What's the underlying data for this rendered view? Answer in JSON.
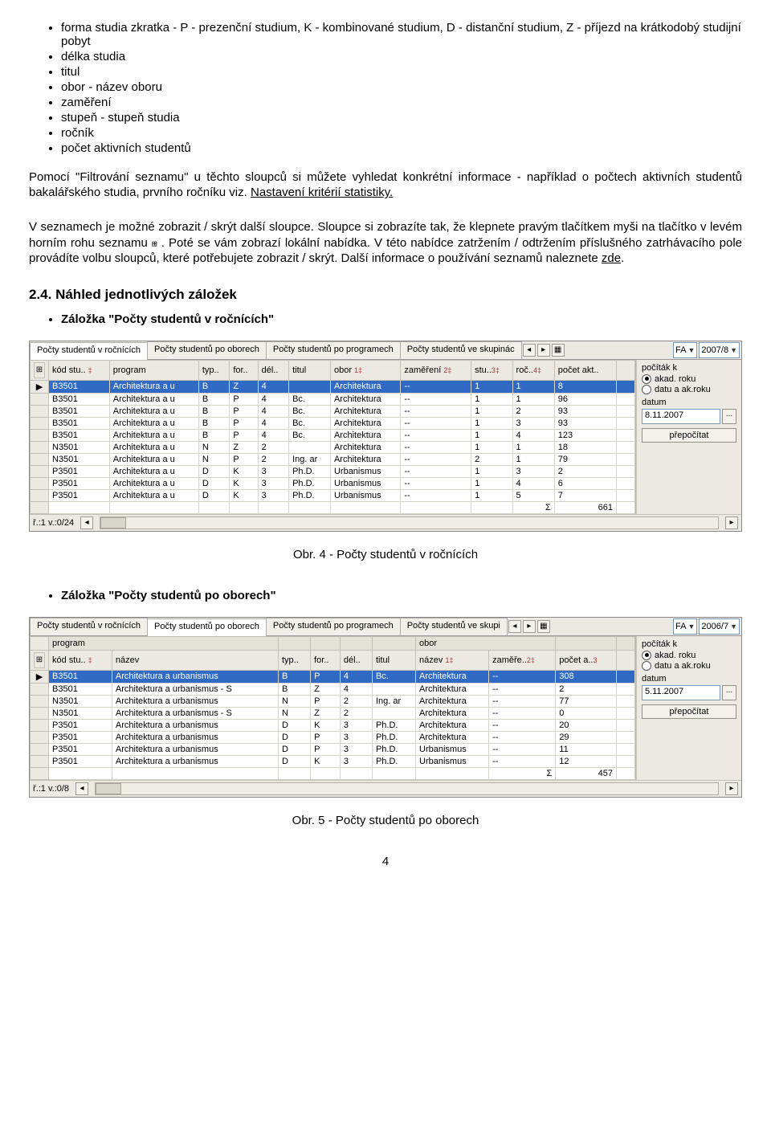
{
  "bullets_top": [
    "forma studia zkratka - P - prezenční studium, K - kombinované studium, D - distanční studium, Z - příjezd na krátkodobý studijní pobyt",
    "délka studia",
    "titul",
    "obor - název oboru",
    "zaměření",
    "stupeň - stupeň studia",
    "ročník",
    "počet aktivních studentů"
  ],
  "para1_a": "Pomocí \"Filtrování seznamu\" u těchto sloupců si můžete vyhledat konkrétní informace - například o počtech aktivních studentů bakalářského studia, prvního ročníku viz. ",
  "para1_link": "Nastavení kritérií statistiky.",
  "para2_a": "V seznamech je možné zobrazit / skrýt další sloupce. Sloupce si zobrazíte tak, že klepnete pravým tlačítkem myši na tlačítko v levém horním rohu seznamu ",
  "para2_b": ". Poté se vám zobrazí lokální nabídka. V této nabídce zatržením / odtržením příslušného zatrhávacího pole provádíte volbu sloupců, které potřebujete zobrazit / skrýt. Další informace o používání seznamů naleznete ",
  "para2_link": "zde",
  "sec_heading": "2.4. Náhled jednotlivých záložek",
  "tab1_title": "Záložka \"Počty studentů v ročnících\"",
  "tab2_title": "Záložka \"Počty studentů po oborech\"",
  "caption1": "Obr. 4 - Počty studentů v ročnících",
  "caption2": "Obr. 5 - Počty studentů po oborech",
  "pagenum": "4",
  "shot1": {
    "tabs": [
      "Počty studentů v ročnících",
      "Počty studentů po oborech",
      "Počty studentů po programech",
      "Počty studentů ve skupinác"
    ],
    "active_tab": 0,
    "fa": "FA",
    "year": "2007/8",
    "headers": [
      "kód stu..",
      "program",
      "typ..",
      "for..",
      "dél..",
      "titul",
      "obor",
      "zaměření",
      "stu..",
      "roč..",
      "počet akt.."
    ],
    "sort_cols": {
      "6": "1",
      "7": "2",
      "8": "3",
      "9": "4"
    },
    "rows": [
      [
        "B3501",
        "Architektura a u",
        "B",
        "Z",
        "4",
        "",
        "Architektura",
        "--",
        "1",
        "1",
        "8"
      ],
      [
        "B3501",
        "Architektura a u",
        "B",
        "P",
        "4",
        "Bc.",
        "Architektura",
        "--",
        "1",
        "1",
        "96"
      ],
      [
        "B3501",
        "Architektura a u",
        "B",
        "P",
        "4",
        "Bc.",
        "Architektura",
        "--",
        "1",
        "2",
        "93"
      ],
      [
        "B3501",
        "Architektura a u",
        "B",
        "P",
        "4",
        "Bc.",
        "Architektura",
        "--",
        "1",
        "3",
        "93"
      ],
      [
        "B3501",
        "Architektura a u",
        "B",
        "P",
        "4",
        "Bc.",
        "Architektura",
        "--",
        "1",
        "4",
        "123"
      ],
      [
        "N3501",
        "Architektura a u",
        "N",
        "Z",
        "2",
        "",
        "Architektura",
        "--",
        "1",
        "1",
        "18"
      ],
      [
        "N3501",
        "Architektura a u",
        "N",
        "P",
        "2",
        "Ing. ar",
        "Architektura",
        "--",
        "2",
        "1",
        "79"
      ],
      [
        "P3501",
        "Architektura a u",
        "D",
        "K",
        "3",
        "Ph.D.",
        "Urbanismus",
        "--",
        "1",
        "3",
        "2"
      ],
      [
        "P3501",
        "Architektura a u",
        "D",
        "K",
        "3",
        "Ph.D.",
        "Urbanismus",
        "--",
        "1",
        "4",
        "6"
      ],
      [
        "P3501",
        "Architektura a u",
        "D",
        "K",
        "3",
        "Ph.D.",
        "Urbanismus",
        "--",
        "1",
        "5",
        "7"
      ]
    ],
    "sum_label": "Σ",
    "sum": "661",
    "side": {
      "pocitak": "počíták k",
      "r1": "akad. roku",
      "r2": "datu a ak.roku",
      "datum_lbl": "datum",
      "datum_val": "8.11.2007",
      "btn": "přepočítat"
    },
    "status": "ř.:1 v.:0/24"
  },
  "shot2": {
    "tabs": [
      "Počty studentů v ročnících",
      "Počty studentů po oborech",
      "Počty studentů po programech",
      "Počty studentů ve skupi"
    ],
    "active_tab": 1,
    "fa": "FA",
    "year": "2006/7",
    "group_headers": [
      "program",
      "",
      "",
      "",
      "",
      "obor",
      "",
      ""
    ],
    "headers": [
      "kód stu..",
      "název",
      "typ..",
      "for..",
      "dél..",
      "titul",
      "název",
      "zaměře..",
      "počet a.."
    ],
    "sort_cols": {
      "6": "1",
      "7": "2",
      "8": "3"
    },
    "rows": [
      [
        "B3501",
        "Architektura a urbanismus",
        "B",
        "P",
        "4",
        "Bc.",
        "Architektura",
        "--",
        "308"
      ],
      [
        "B3501",
        "Architektura a urbanismus - S",
        "B",
        "Z",
        "4",
        "",
        "Architektura",
        "--",
        "2"
      ],
      [
        "N3501",
        "Architektura a urbanismus",
        "N",
        "P",
        "2",
        "Ing. ar",
        "Architektura",
        "--",
        "77"
      ],
      [
        "N3501",
        "Architektura a urbanismus - S",
        "N",
        "Z",
        "2",
        "",
        "Architektura",
        "--",
        "0"
      ],
      [
        "P3501",
        "Architektura a urbanismus",
        "D",
        "K",
        "3",
        "Ph.D.",
        "Architektura",
        "--",
        "20"
      ],
      [
        "P3501",
        "Architektura a urbanismus",
        "D",
        "P",
        "3",
        "Ph.D.",
        "Architektura",
        "--",
        "29"
      ],
      [
        "P3501",
        "Architektura a urbanismus",
        "D",
        "P",
        "3",
        "Ph.D.",
        "Urbanismus",
        "--",
        "11"
      ],
      [
        "P3501",
        "Architektura a urbanismus",
        "D",
        "K",
        "3",
        "Ph.D.",
        "Urbanismus",
        "--",
        "12"
      ]
    ],
    "sum_label": "Σ",
    "sum": "457",
    "side": {
      "pocitak": "počíták k",
      "r1": "akad. roku",
      "r2": "datu a ak.roku",
      "datum_lbl": "datum",
      "datum_val": "5.11.2007",
      "btn": "přepočítat"
    },
    "status": "ř.:1 v.:0/8"
  }
}
